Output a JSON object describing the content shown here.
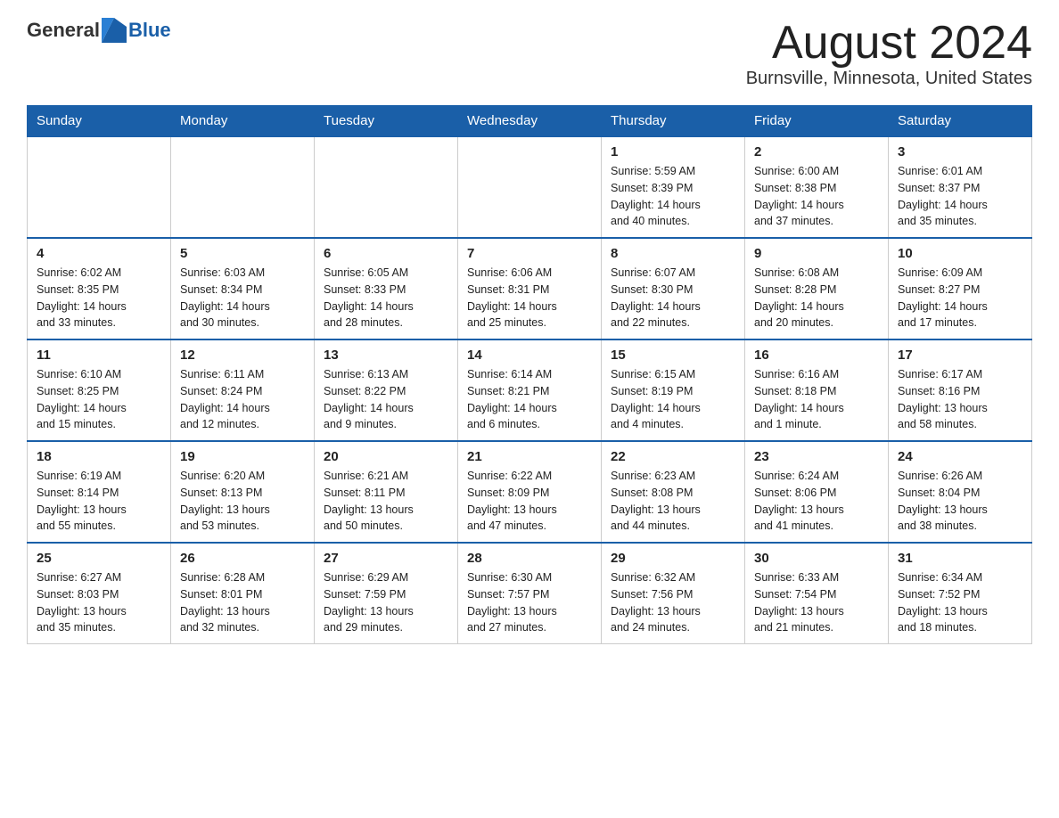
{
  "header": {
    "logo_general": "General",
    "logo_blue": "Blue",
    "month_title": "August 2024",
    "location": "Burnsville, Minnesota, United States"
  },
  "days_of_week": [
    "Sunday",
    "Monday",
    "Tuesday",
    "Wednesday",
    "Thursday",
    "Friday",
    "Saturday"
  ],
  "weeks": [
    [
      {
        "day": "",
        "info": ""
      },
      {
        "day": "",
        "info": ""
      },
      {
        "day": "",
        "info": ""
      },
      {
        "day": "",
        "info": ""
      },
      {
        "day": "1",
        "info": "Sunrise: 5:59 AM\nSunset: 8:39 PM\nDaylight: 14 hours\nand 40 minutes."
      },
      {
        "day": "2",
        "info": "Sunrise: 6:00 AM\nSunset: 8:38 PM\nDaylight: 14 hours\nand 37 minutes."
      },
      {
        "day": "3",
        "info": "Sunrise: 6:01 AM\nSunset: 8:37 PM\nDaylight: 14 hours\nand 35 minutes."
      }
    ],
    [
      {
        "day": "4",
        "info": "Sunrise: 6:02 AM\nSunset: 8:35 PM\nDaylight: 14 hours\nand 33 minutes."
      },
      {
        "day": "5",
        "info": "Sunrise: 6:03 AM\nSunset: 8:34 PM\nDaylight: 14 hours\nand 30 minutes."
      },
      {
        "day": "6",
        "info": "Sunrise: 6:05 AM\nSunset: 8:33 PM\nDaylight: 14 hours\nand 28 minutes."
      },
      {
        "day": "7",
        "info": "Sunrise: 6:06 AM\nSunset: 8:31 PM\nDaylight: 14 hours\nand 25 minutes."
      },
      {
        "day": "8",
        "info": "Sunrise: 6:07 AM\nSunset: 8:30 PM\nDaylight: 14 hours\nand 22 minutes."
      },
      {
        "day": "9",
        "info": "Sunrise: 6:08 AM\nSunset: 8:28 PM\nDaylight: 14 hours\nand 20 minutes."
      },
      {
        "day": "10",
        "info": "Sunrise: 6:09 AM\nSunset: 8:27 PM\nDaylight: 14 hours\nand 17 minutes."
      }
    ],
    [
      {
        "day": "11",
        "info": "Sunrise: 6:10 AM\nSunset: 8:25 PM\nDaylight: 14 hours\nand 15 minutes."
      },
      {
        "day": "12",
        "info": "Sunrise: 6:11 AM\nSunset: 8:24 PM\nDaylight: 14 hours\nand 12 minutes."
      },
      {
        "day": "13",
        "info": "Sunrise: 6:13 AM\nSunset: 8:22 PM\nDaylight: 14 hours\nand 9 minutes."
      },
      {
        "day": "14",
        "info": "Sunrise: 6:14 AM\nSunset: 8:21 PM\nDaylight: 14 hours\nand 6 minutes."
      },
      {
        "day": "15",
        "info": "Sunrise: 6:15 AM\nSunset: 8:19 PM\nDaylight: 14 hours\nand 4 minutes."
      },
      {
        "day": "16",
        "info": "Sunrise: 6:16 AM\nSunset: 8:18 PM\nDaylight: 14 hours\nand 1 minute."
      },
      {
        "day": "17",
        "info": "Sunrise: 6:17 AM\nSunset: 8:16 PM\nDaylight: 13 hours\nand 58 minutes."
      }
    ],
    [
      {
        "day": "18",
        "info": "Sunrise: 6:19 AM\nSunset: 8:14 PM\nDaylight: 13 hours\nand 55 minutes."
      },
      {
        "day": "19",
        "info": "Sunrise: 6:20 AM\nSunset: 8:13 PM\nDaylight: 13 hours\nand 53 minutes."
      },
      {
        "day": "20",
        "info": "Sunrise: 6:21 AM\nSunset: 8:11 PM\nDaylight: 13 hours\nand 50 minutes."
      },
      {
        "day": "21",
        "info": "Sunrise: 6:22 AM\nSunset: 8:09 PM\nDaylight: 13 hours\nand 47 minutes."
      },
      {
        "day": "22",
        "info": "Sunrise: 6:23 AM\nSunset: 8:08 PM\nDaylight: 13 hours\nand 44 minutes."
      },
      {
        "day": "23",
        "info": "Sunrise: 6:24 AM\nSunset: 8:06 PM\nDaylight: 13 hours\nand 41 minutes."
      },
      {
        "day": "24",
        "info": "Sunrise: 6:26 AM\nSunset: 8:04 PM\nDaylight: 13 hours\nand 38 minutes."
      }
    ],
    [
      {
        "day": "25",
        "info": "Sunrise: 6:27 AM\nSunset: 8:03 PM\nDaylight: 13 hours\nand 35 minutes."
      },
      {
        "day": "26",
        "info": "Sunrise: 6:28 AM\nSunset: 8:01 PM\nDaylight: 13 hours\nand 32 minutes."
      },
      {
        "day": "27",
        "info": "Sunrise: 6:29 AM\nSunset: 7:59 PM\nDaylight: 13 hours\nand 29 minutes."
      },
      {
        "day": "28",
        "info": "Sunrise: 6:30 AM\nSunset: 7:57 PM\nDaylight: 13 hours\nand 27 minutes."
      },
      {
        "day": "29",
        "info": "Sunrise: 6:32 AM\nSunset: 7:56 PM\nDaylight: 13 hours\nand 24 minutes."
      },
      {
        "day": "30",
        "info": "Sunrise: 6:33 AM\nSunset: 7:54 PM\nDaylight: 13 hours\nand 21 minutes."
      },
      {
        "day": "31",
        "info": "Sunrise: 6:34 AM\nSunset: 7:52 PM\nDaylight: 13 hours\nand 18 minutes."
      }
    ]
  ]
}
